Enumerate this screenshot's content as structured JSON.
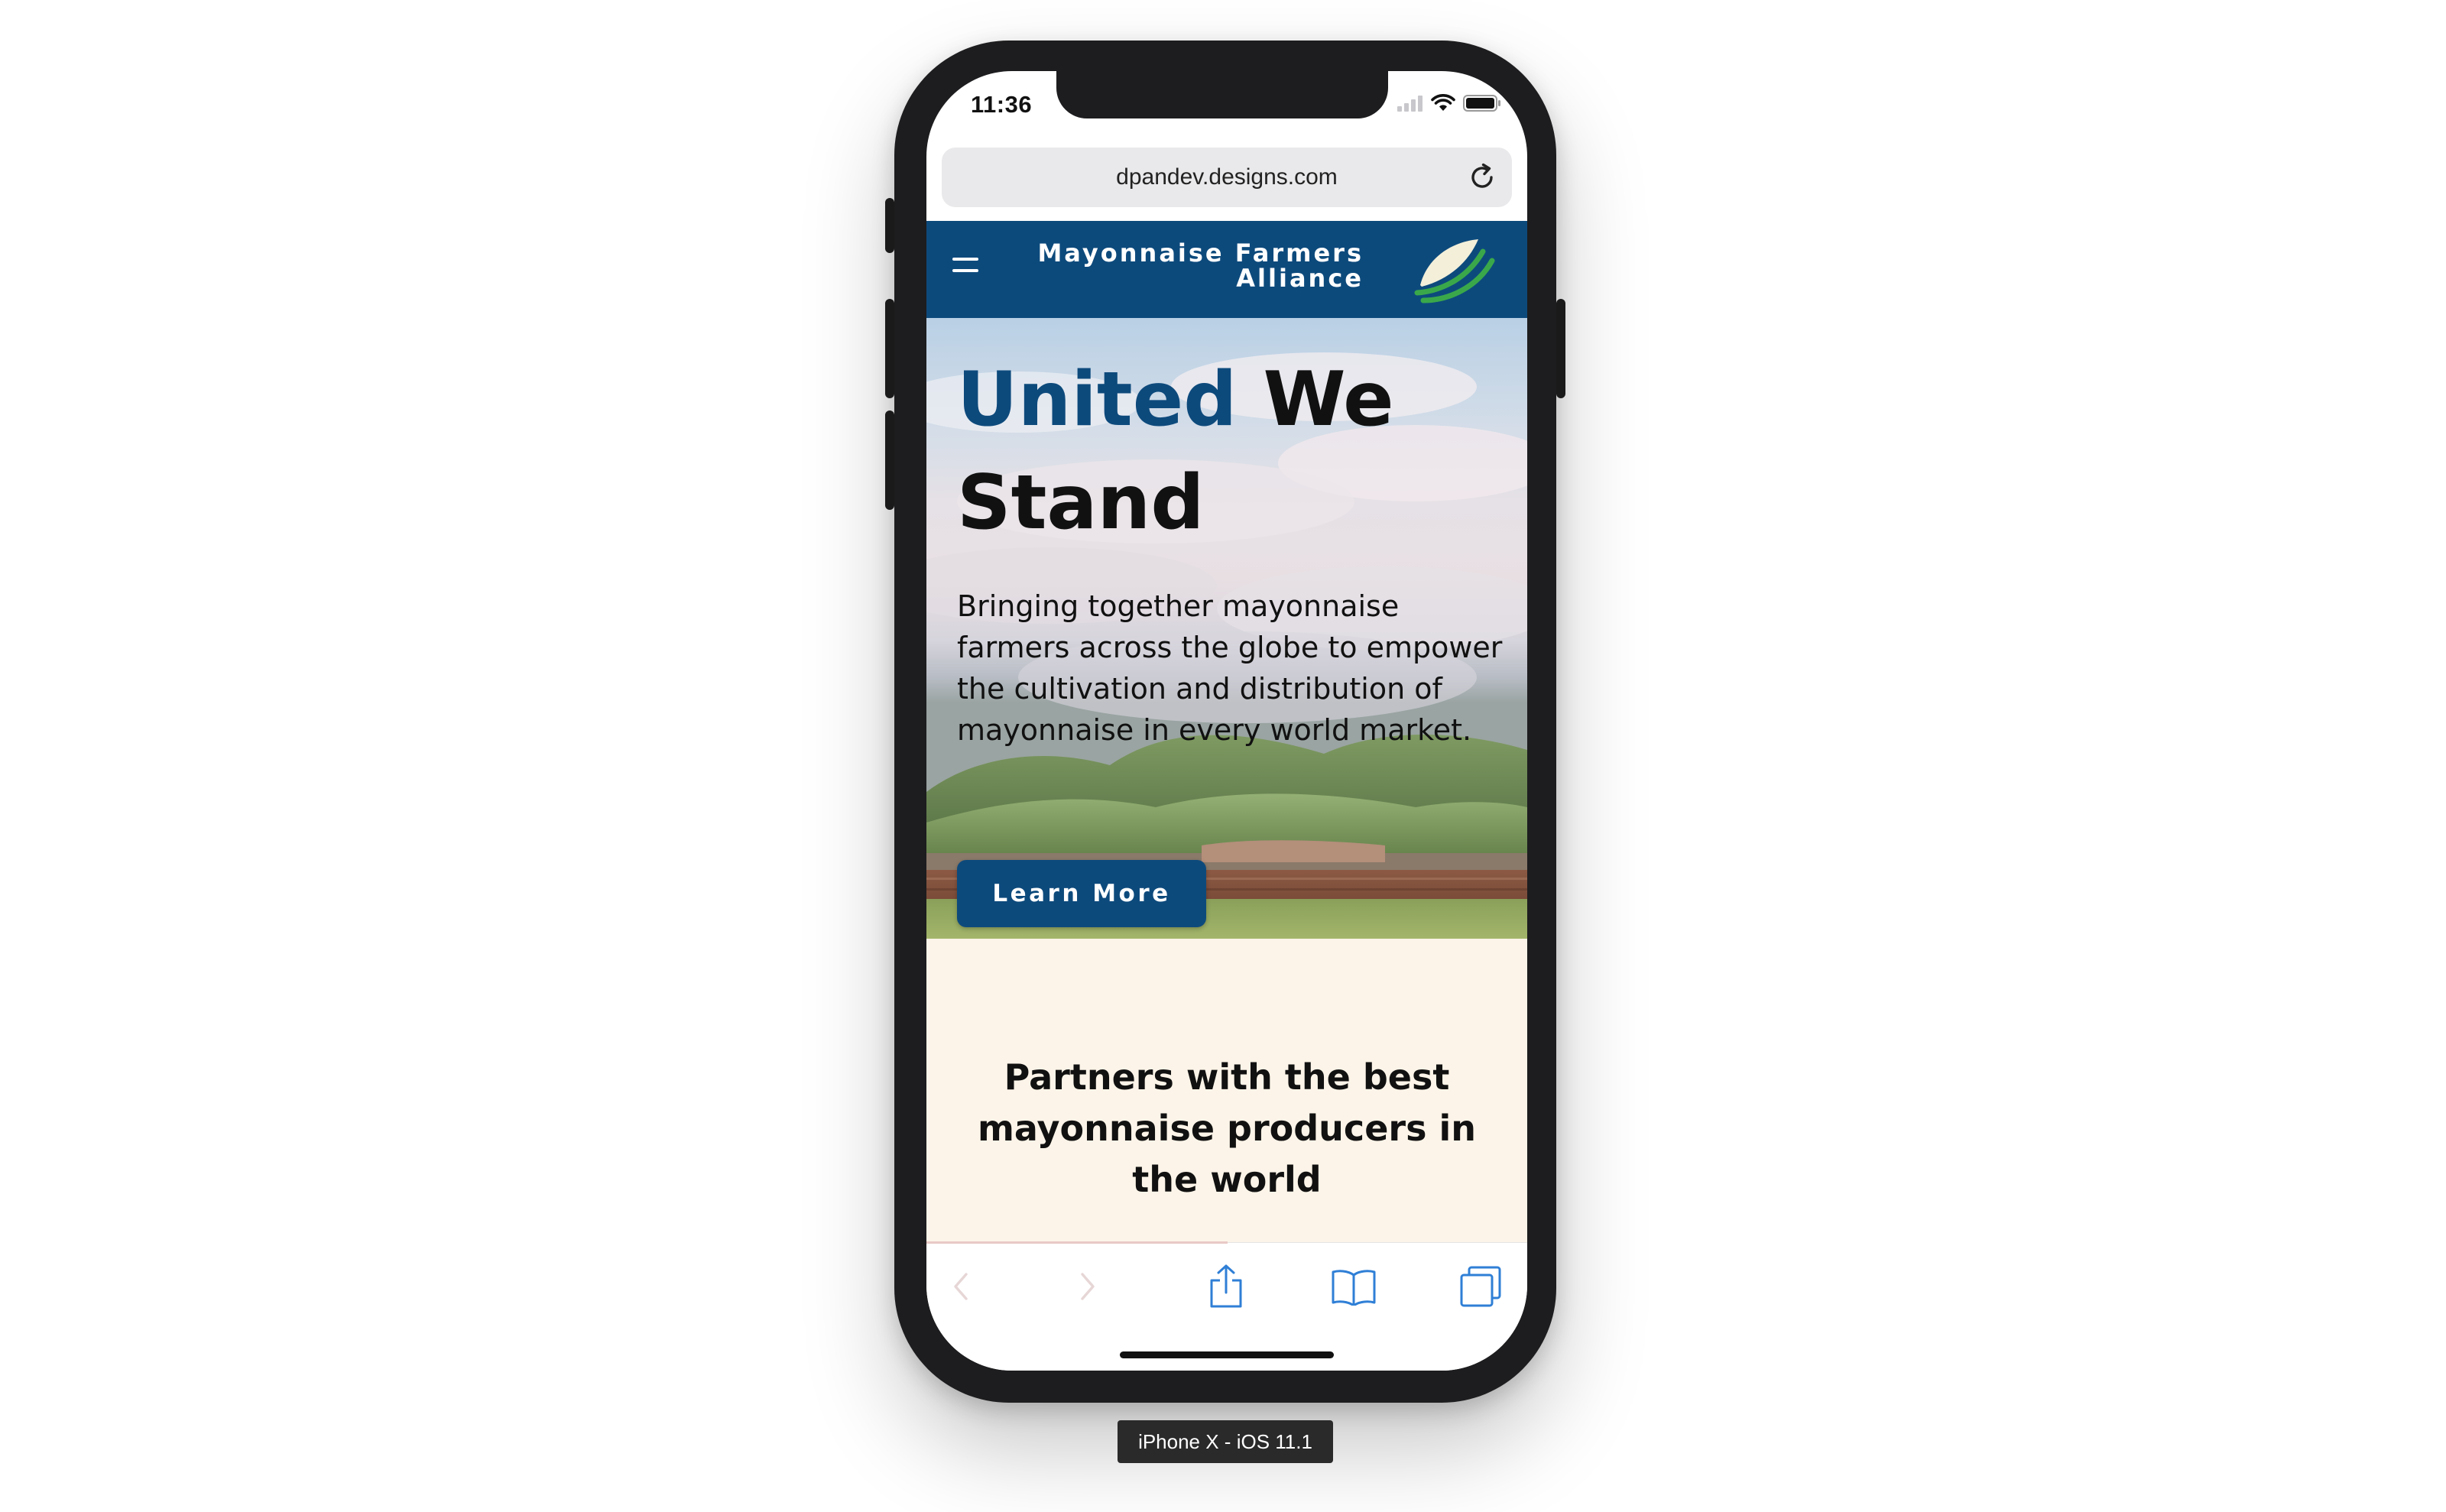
{
  "status_bar": {
    "time": "11:36"
  },
  "browser": {
    "url": "dpandev.designs.com"
  },
  "site": {
    "brand_line1": "Mayonnaise Farmers",
    "brand_line2": "Alliance",
    "colors": {
      "primary": "#0d4a7c",
      "logo_green": "#3aa84a",
      "cream": "#fcf4e8"
    }
  },
  "hero": {
    "title_accent": "United",
    "title_rest_line1": "We",
    "title_line2": "Stand",
    "copy": "Bringing together mayonnaise farmers across the globe to empower the cultivation and distribution of mayonnaise in every world market.",
    "cta_label": "Learn More"
  },
  "partners": {
    "heading": "Partners with the best mayonnaise producers in the world"
  },
  "toolbar": {
    "icons": [
      "back-icon",
      "forward-icon",
      "share-icon",
      "bookmarks-icon",
      "tabs-icon"
    ]
  },
  "simulator": {
    "label": "iPhone X - iOS 11.1"
  }
}
